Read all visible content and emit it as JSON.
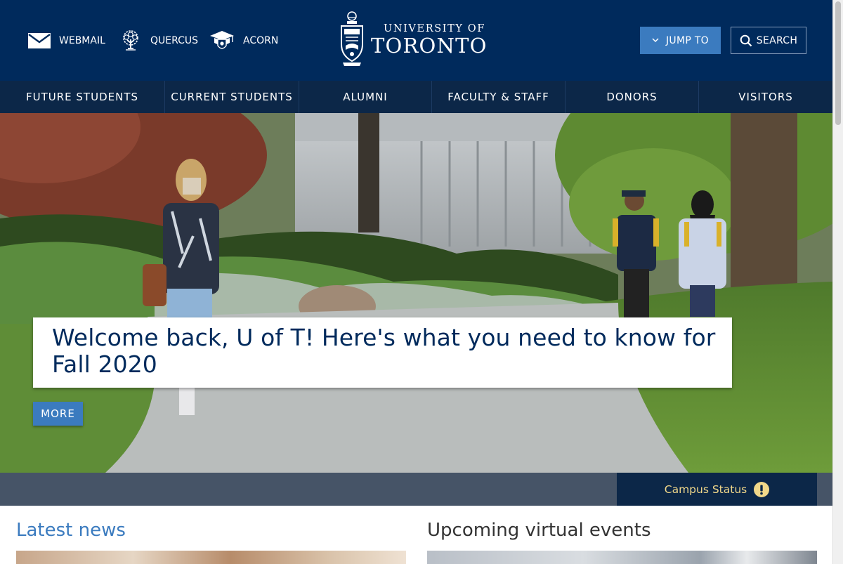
{
  "header": {
    "quick_links": [
      {
        "label": "WEBMAIL",
        "icon": "envelope-icon"
      },
      {
        "label": "QUERCUS",
        "icon": "tree-icon"
      },
      {
        "label": "ACORN",
        "icon": "mortarboard-shield-icon"
      }
    ],
    "logo": {
      "line1": "UNIVERSITY OF",
      "line2": "TORONTO",
      "icon": "university-crest-icon"
    },
    "jump_to_label": "JUMP TO",
    "search_label": "SEARCH"
  },
  "nav": {
    "items": [
      "FUTURE STUDENTS",
      "CURRENT STUDENTS",
      "ALUMNI",
      "FACULTY & STAFF",
      "DONORS",
      "VISITORS"
    ]
  },
  "hero": {
    "headline": "Welcome back, U of T! Here's what you need to know for Fall 2020",
    "more_label": "MORE"
  },
  "status": {
    "label": "Campus Status",
    "icon": "exclamation-circle-icon"
  },
  "sections": {
    "latest_news": "Latest news",
    "upcoming_events": "Upcoming virtual events"
  },
  "colors": {
    "navy": "#002a5c",
    "nav_bg": "#0c2748",
    "accent_blue": "#3b7bbf",
    "status_gold": "#f2d88a",
    "strip_gray": "#465467"
  }
}
